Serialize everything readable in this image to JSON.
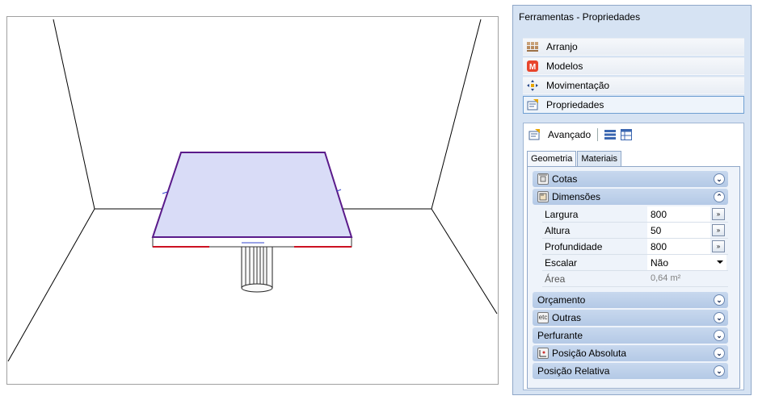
{
  "panel": {
    "title": "Ferramentas - Propriedades",
    "nav": [
      {
        "label": "Arranjo",
        "icon": "arrangement-icon"
      },
      {
        "label": "Modelos",
        "icon": "models-icon"
      },
      {
        "label": "Movimentação",
        "icon": "move-icon"
      },
      {
        "label": "Propriedades",
        "icon": "properties-icon",
        "active": true
      }
    ],
    "advanced_label": "Avançado",
    "tabs": [
      {
        "label": "Geometria",
        "active": true
      },
      {
        "label": "Materiais",
        "active": false
      }
    ],
    "groups": {
      "cotas": "Cotas",
      "dimensoes": "Dimensões",
      "orcamento": "Orçamento",
      "outras": "Outras",
      "outras_icon_text": "etc",
      "perfurante": "Perfurante",
      "posicao_absoluta": "Posição Absoluta",
      "posicao_relativa": "Posição Relativa"
    },
    "dimensions": {
      "largura": {
        "label": "Largura",
        "value": "800"
      },
      "altura": {
        "label": "Altura",
        "value": "50"
      },
      "profundidade": {
        "label": "Profundidade",
        "value": "800"
      },
      "escalar": {
        "label": "Escalar",
        "value": "Não"
      },
      "area": {
        "label": "Área",
        "value": "0,64 m²"
      }
    },
    "button_glyph": "»"
  },
  "colors": {
    "panel_bg": "#d6e3f3",
    "group_header": "#b4c9e6",
    "tabletop": "#d9dcf7",
    "edge_purple": "#5a1a8a",
    "edge_red": "#cc1122"
  }
}
